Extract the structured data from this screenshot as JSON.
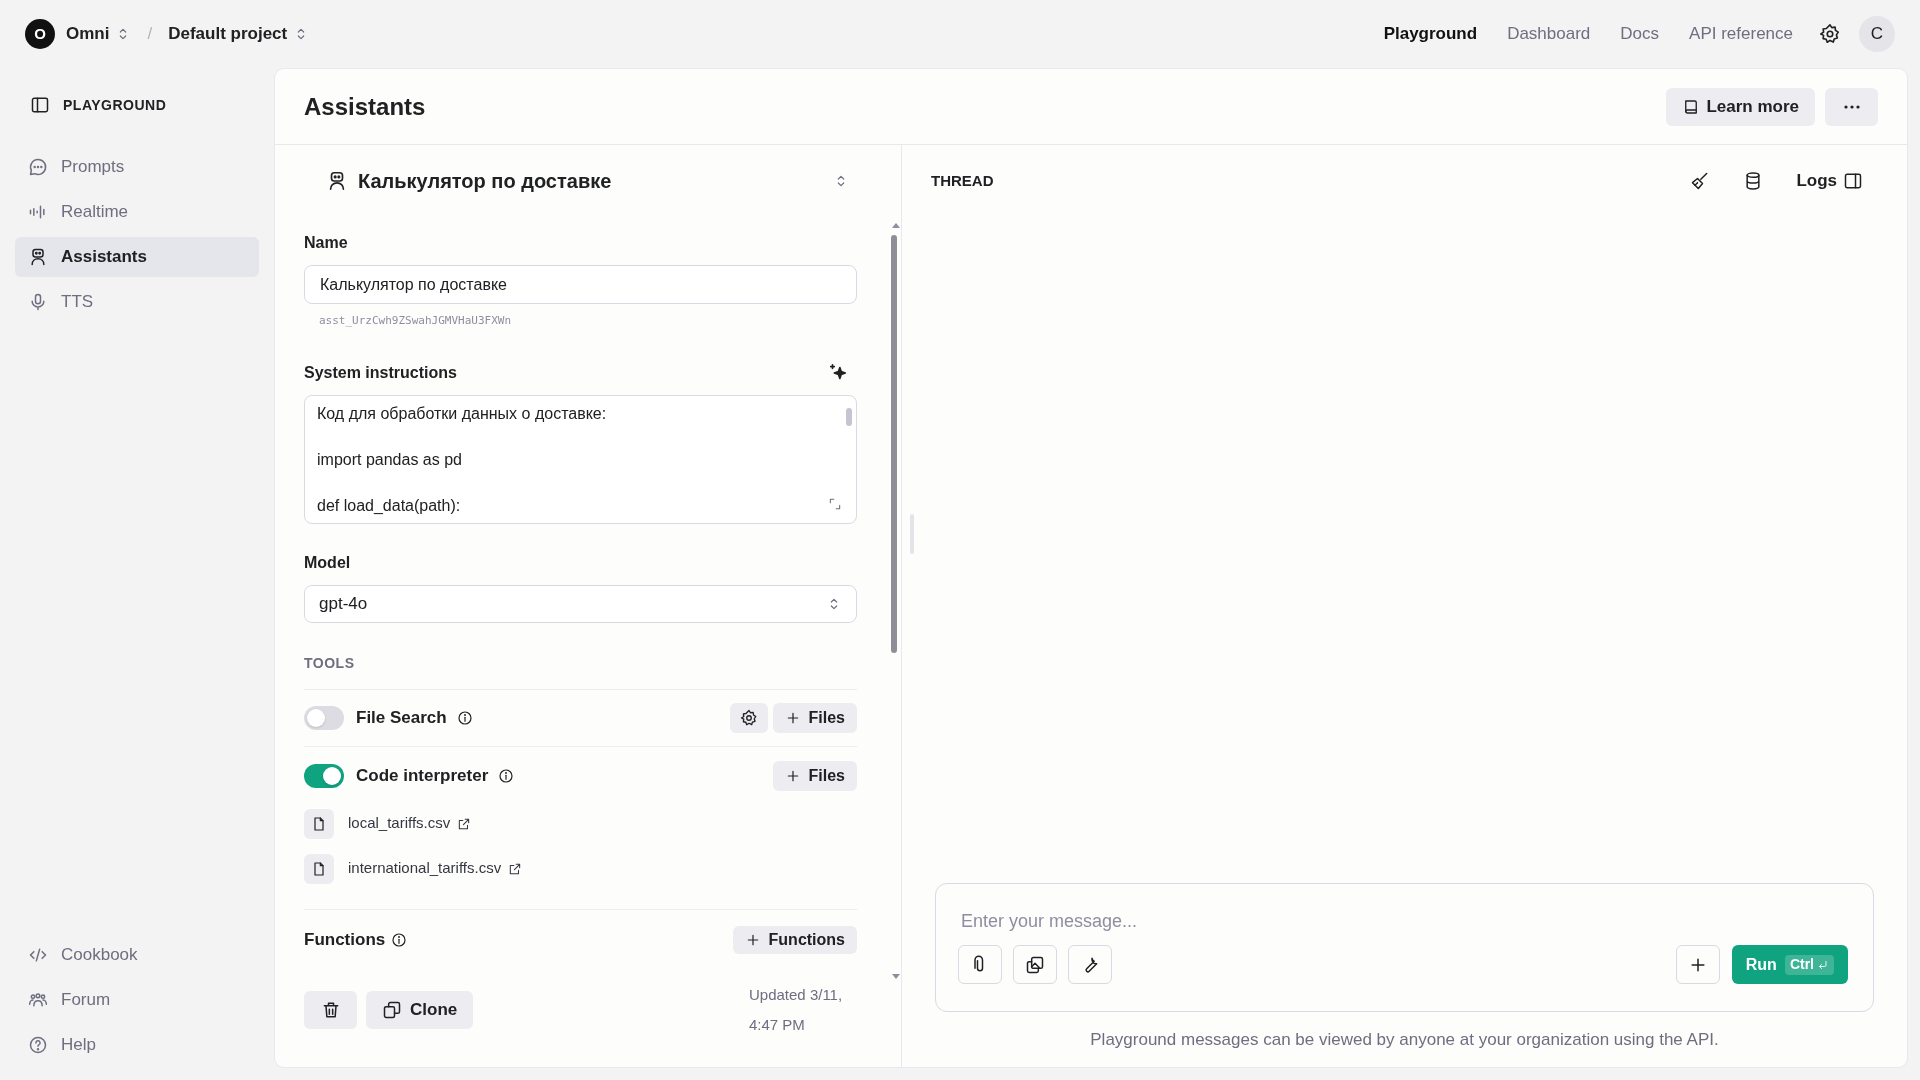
{
  "org": {
    "initial": "O",
    "name": "Omni"
  },
  "separator": "/",
  "project": "Default project",
  "nav": [
    {
      "label": "Playground",
      "selected": true
    },
    {
      "label": "Dashboard",
      "selected": false
    },
    {
      "label": "Docs",
      "selected": false
    },
    {
      "label": "API reference",
      "selected": false
    }
  ],
  "avatar": "C",
  "sidebar": {
    "title": "PLAYGROUND",
    "items": [
      {
        "label": "Prompts",
        "selected": false
      },
      {
        "label": "Realtime",
        "selected": false
      },
      {
        "label": "Assistants",
        "selected": true
      },
      {
        "label": "TTS",
        "selected": false
      }
    ],
    "footer_items": [
      {
        "label": "Cookbook"
      },
      {
        "label": "Forum"
      },
      {
        "label": "Help"
      }
    ]
  },
  "page": {
    "title": "Assistants",
    "learn_more": "Learn more"
  },
  "assistant": {
    "title": "Калькулятор по доставке",
    "name_label": "Name",
    "name_value": "Калькулятор по доставке",
    "id": "asst_UrzCwh9ZSwahJGMVHaU3FXWn",
    "instructions_label": "System instructions",
    "instructions": [
      "Код для обработки данных о доставке:",
      "import pandas as pd",
      "def load_data(path):"
    ],
    "model_label": "Model",
    "model": "gpt-4o",
    "tools_heading": "TOOLS",
    "tools": [
      {
        "kind": "configurable",
        "label": "File Search",
        "on": false,
        "files_button": "Files"
      },
      {
        "kind": "plain",
        "label": "Code interpreter",
        "on": true,
        "files_button": "Files",
        "files": [
          "local_tariffs.csv",
          "international_tariffs.csv"
        ]
      }
    ],
    "functions": {
      "label": "Functions",
      "button": "Functions"
    },
    "clone": "Clone",
    "updated": "Updated 3/11, 4:47 PM"
  },
  "thread": {
    "title": "THREAD",
    "logs": "Logs",
    "placeholder": "Enter your message...",
    "run": "Run",
    "shortcut": "Ctrl",
    "note": "Playground messages can be viewed by anyone at your organization using the API."
  }
}
